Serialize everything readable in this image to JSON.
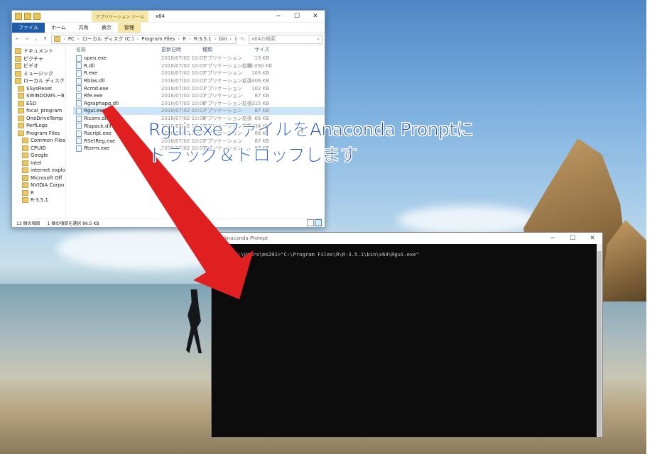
{
  "explorer": {
    "ribbon_context_label": "アプリケーション ツール",
    "window_title": "x64",
    "ribbon_tabs": [
      "ファイル",
      "ホーム",
      "共有",
      "表示",
      "管理"
    ],
    "breadcrumb": [
      "PC",
      "ローカル ディスク (C:)",
      "Program Files",
      "R",
      "R-3.5.1",
      "bin",
      "x64"
    ],
    "search_placeholder": "x64の検索",
    "nav_items": [
      "ドキュメント",
      "ピクチャ",
      "ビデオ",
      "ミュージック",
      "ローカル ディスク (C",
      "$SysReset",
      "$WINDOWS.~B",
      "ESD",
      "focal_program",
      "OneDriveTemp",
      "PerfLogs",
      "Program Files",
      "Common Files",
      "CPUID",
      "Google",
      "Intel",
      "internet explo",
      "Microsoft Off",
      "NVIDIA Corpo",
      "R",
      "R-3.5.1"
    ],
    "columns": [
      "名前",
      "更新日時",
      "種類",
      "サイズ"
    ],
    "files": [
      {
        "name": "open.exe",
        "date": "2018/07/02 10:07",
        "type": "アプリケーション",
        "size": "19 KB"
      },
      {
        "name": "R.dll",
        "date": "2018/07/02 10:07",
        "type": "アプリケーション拡張",
        "size": "30,090 KB"
      },
      {
        "name": "R.exe",
        "date": "2018/07/02 10:07",
        "type": "アプリケーション",
        "size": "103 KB"
      },
      {
        "name": "Rblas.dll",
        "date": "2018/07/02 10:07",
        "type": "アプリケーション拡張",
        "size": "306 KB"
      },
      {
        "name": "Rcmd.exe",
        "date": "2018/07/02 10:07",
        "type": "アプリケーション",
        "size": "102 KB"
      },
      {
        "name": "Rfe.exe",
        "date": "2018/07/02 10:07",
        "type": "アプリケーション",
        "size": "87 KB"
      },
      {
        "name": "Rgraphapp.dll",
        "date": "2018/07/02 10:06",
        "type": "アプリケーション拡張",
        "size": "315 KB"
      },
      {
        "name": "Rgui.exe",
        "date": "2018/07/02 10:07",
        "type": "アプリケーション",
        "size": "87 KB"
      },
      {
        "name": "Riconv.dll",
        "date": "2018/07/02 10:06",
        "type": "アプリケーション拡張",
        "size": "66 KB"
      },
      {
        "name": "Rlapack.dll",
        "date": "2018/07/02 10:07",
        "type": "アプリケーション拡張",
        "size": "2,434 KB"
      },
      {
        "name": "Rscript.exe",
        "date": "2018/07/02 10:07",
        "type": "アプリケーション",
        "size": "86 KB"
      },
      {
        "name": "RSetReg.exe",
        "date": "2018/07/02 10:07",
        "type": "アプリケーション",
        "size": "87 KB"
      },
      {
        "name": "Rterm.exe",
        "date": "2018/07/02 10:07",
        "type": "アプリケーション",
        "size": "87 KB"
      }
    ],
    "status_count": "13 個の項目",
    "status_selection": "1 個の項目を選択  86.5 KB"
  },
  "prompt": {
    "title": "Anaconda Prompt",
    "command_line": "(base) C:\\Users\\ms201>\"C:\\Program Files\\R\\R-3.5.1\\bin\\x64\\Rgui.exe\""
  },
  "annotation": {
    "line1": "Rgui.exeファイルをAnaconda Pronptに",
    "line2": "ドラッグ＆ドロップします",
    "color": "#1a4fd6",
    "arrow_color": "#e02020"
  }
}
